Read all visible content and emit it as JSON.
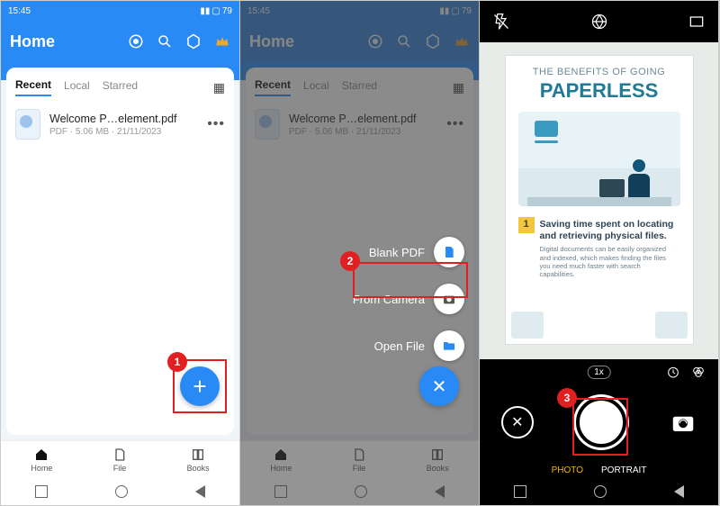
{
  "status": {
    "time": "15:45",
    "battery": "79"
  },
  "header": {
    "title": "Home"
  },
  "tabs": [
    "Recent",
    "Local",
    "Starred"
  ],
  "file": {
    "name": "Welcome P…element.pdf",
    "type": "PDF",
    "size": "5.06 MB",
    "date": "21/11/2023"
  },
  "nav": {
    "home": "Home",
    "file": "File",
    "books": "Books"
  },
  "actions": {
    "blank": "Blank PDF",
    "camera": "From Camera",
    "open": "Open File"
  },
  "steps": {
    "s1": "1",
    "s2": "2",
    "s3": "3"
  },
  "poster": {
    "line1": "THE BENEFITS OF GOING",
    "line2": "PAPERLESS",
    "benefitNum": "1",
    "benefitHeading": "Saving time spent on locating and retrieving physical files.",
    "benefitSub": "Digital documents can be easily organized and indexed, which makes finding the files you need much faster with search capabilities."
  },
  "camera": {
    "zoom": "1x",
    "modes": {
      "photo": "PHOTO",
      "portrait": "PORTRAIT"
    }
  }
}
